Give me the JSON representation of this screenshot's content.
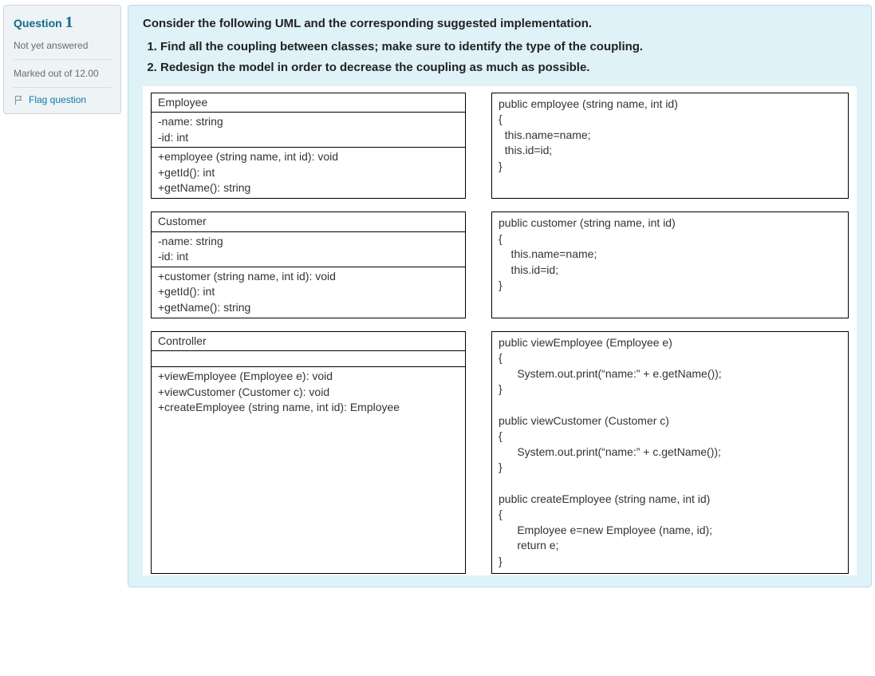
{
  "sidebar": {
    "question_label": "Question",
    "question_number": "1",
    "status": "Not yet answered",
    "marks_label": "Marked out of 12.00",
    "flag_label": "Flag question"
  },
  "content": {
    "intro": "Consider the following UML and the corresponding suggested implementation.",
    "tasks": [
      "Find all the coupling between classes; make sure to identify the type of the coupling.",
      "Redesign the model in order to decrease the coupling as much as possible."
    ]
  },
  "uml": [
    {
      "name": "Employee",
      "attrs": [
        "-name: string",
        "-id: int"
      ],
      "ops": [
        "+employee (string name, int id): void",
        "+getId(): int",
        "+getName(): string"
      ],
      "code": "public employee (string name, int id)\n{\n  this.name=name;\n  this.id=id;\n}"
    },
    {
      "name": "Customer",
      "attrs": [
        "-name: string",
        "-id: int"
      ],
      "ops": [
        "+customer (string name, int id): void",
        "+getId(): int",
        "+getName(): string"
      ],
      "code": "public customer (string name, int id)\n{\n    this.name=name;\n    this.id=id;\n}"
    },
    {
      "name": "Controller",
      "attrs": [],
      "ops": [
        "+viewEmployee (Employee e): void",
        "+viewCustomer (Customer c): void",
        "+createEmployee (string name, int id): Employee"
      ],
      "code": "public viewEmployee (Employee e)\n{\n      System.out.print(“name:” + e.getName());\n}\n\npublic viewCustomer (Customer c)\n{\n      System.out.print(“name:” + c.getName());\n}\n\npublic createEmployee (string name, int id)\n{\n      Employee e=new Employee (name, id);\n      return e;\n}"
    }
  ]
}
